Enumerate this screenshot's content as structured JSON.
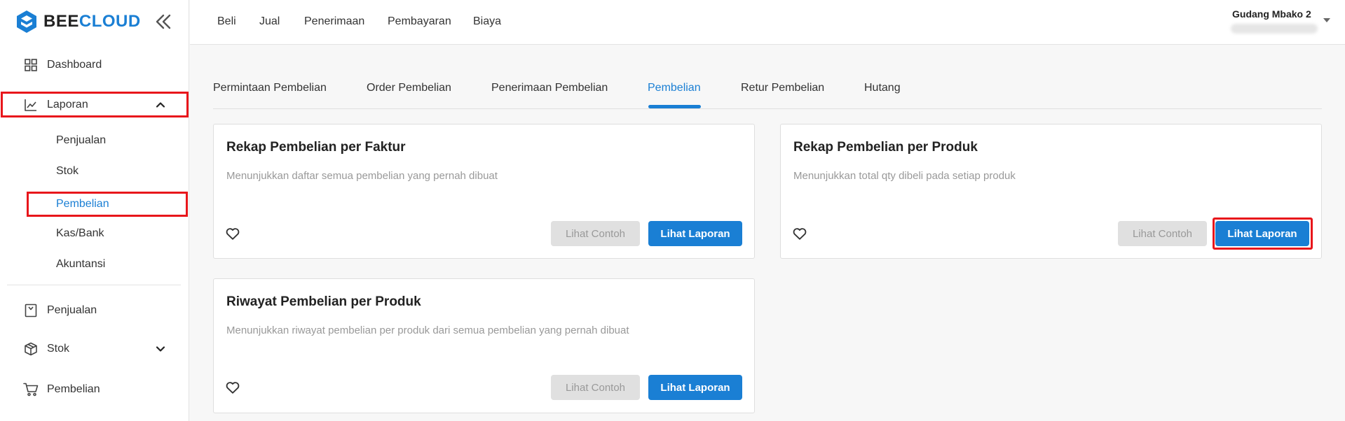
{
  "brand": {
    "bee": "BEE",
    "cloud": "CLOUD",
    "accent": "#1a7fd4"
  },
  "sidebar": {
    "dashboard": "Dashboard",
    "laporan": "Laporan",
    "sub_items": [
      "Penjualan",
      "Stok",
      "Pembelian",
      "Kas/Bank",
      "Akuntansi"
    ],
    "penjualan": "Penjualan",
    "stok": "Stok",
    "pembelian": "Pembelian"
  },
  "topnav": [
    "Beli",
    "Jual",
    "Penerimaan",
    "Pembayaran",
    "Biaya"
  ],
  "user": {
    "name": "Gudang Mbako 2"
  },
  "tabs": [
    "Permintaan Pembelian",
    "Order Pembelian",
    "Penerimaan Pembelian",
    "Pembelian",
    "Retur Pembelian",
    "Hutang"
  ],
  "active_tab": "Pembelian",
  "cards": [
    {
      "title": "Rekap Pembelian per Faktur",
      "desc": "Menunjukkan daftar semua pembelian yang pernah dibuat",
      "example": "Lihat Contoh",
      "view": "Lihat Laporan"
    },
    {
      "title": "Rekap Pembelian per Produk",
      "desc": "Menunjukkan total qty dibeli pada setiap produk",
      "example": "Lihat Contoh",
      "view": "Lihat Laporan"
    },
    {
      "title": "Riwayat Pembelian per Produk",
      "desc": "Menunjukkan riwayat pembelian per produk dari semua pembelian yang pernah dibuat",
      "example": "Lihat Contoh",
      "view": "Lihat Laporan"
    }
  ]
}
